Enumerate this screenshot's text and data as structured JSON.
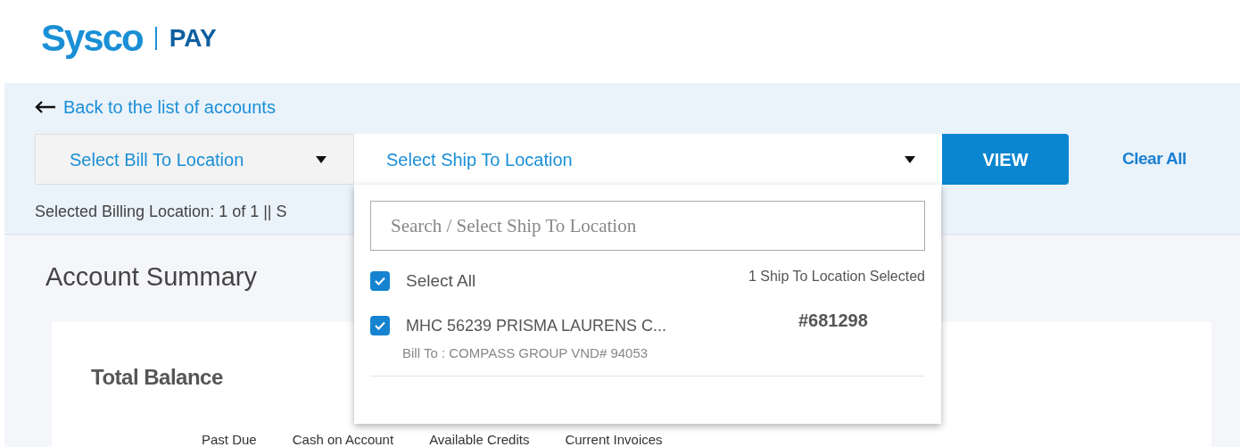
{
  "logo": {
    "brand": "Sysco",
    "product": "PAY"
  },
  "back_link": "Back to the list of accounts",
  "filters": {
    "bill_to": "Select Bill To Location",
    "ship_to": {
      "label": "Select Ship To Location",
      "expanded": true
    },
    "view_button": "VIEW",
    "clear_all": "Clear All"
  },
  "selection_summary": "Selected Billing Location: 1 of 1 || S",
  "dropdown": {
    "search_placeholder": "Search / Select Ship To Location",
    "select_all": {
      "label": "Select All",
      "checked": true
    },
    "count": "1 Ship To Location Selected",
    "items": [
      {
        "name": "MHC 56239 PRISMA LAURENS C...",
        "bill_to": "Bill To : COMPASS GROUP VND# 94053",
        "number": "#681298",
        "checked": true
      }
    ]
  },
  "account_summary": {
    "title": "Account Summary",
    "card_title": "Total Balance",
    "columns": [
      "Past Due",
      "Cash on Account",
      "Available Credits",
      "Current Invoices"
    ]
  }
}
